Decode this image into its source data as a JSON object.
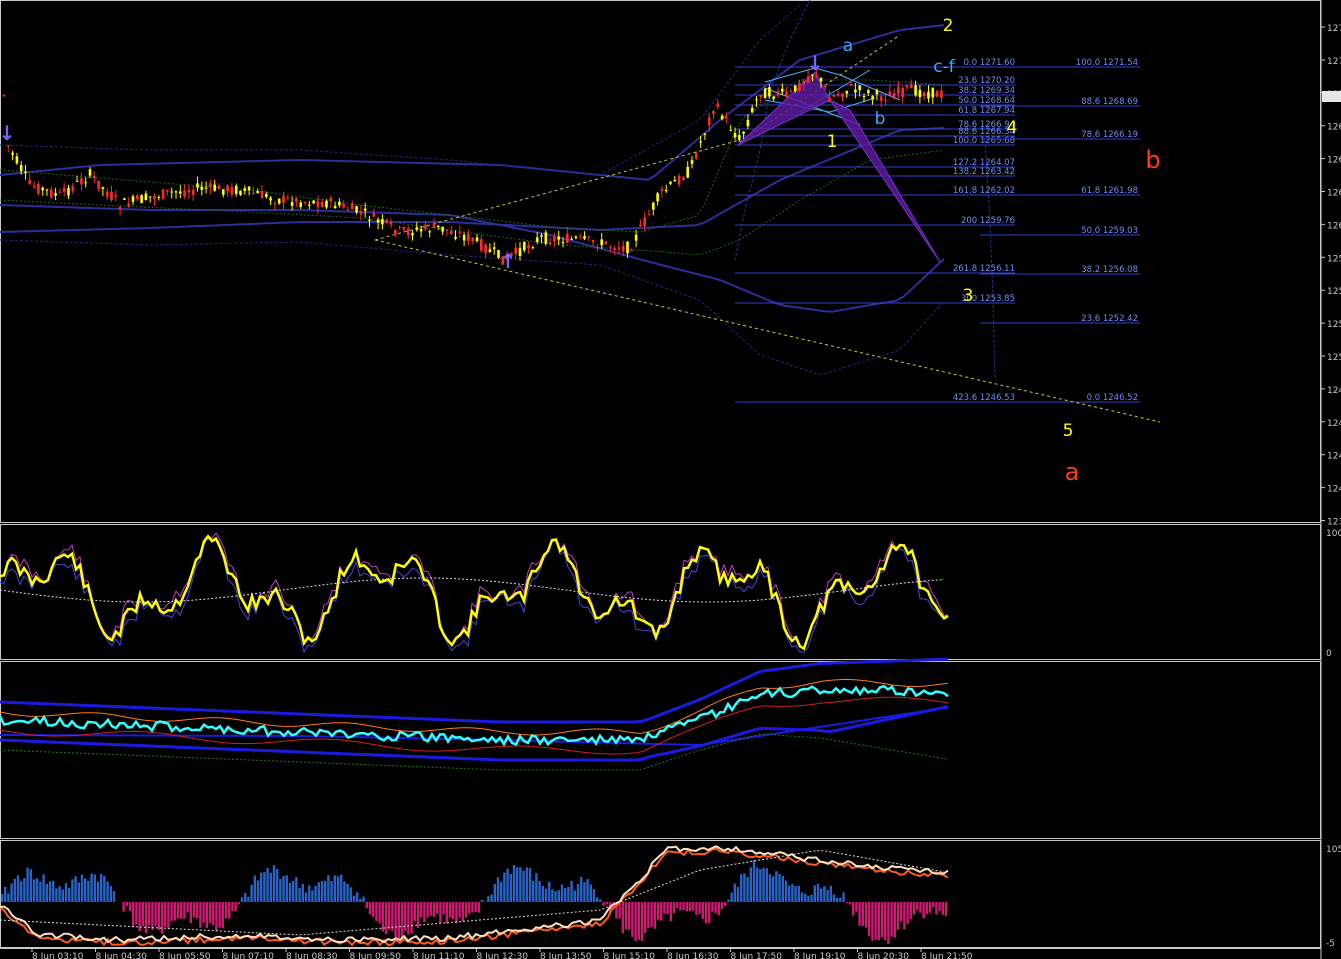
{
  "colors": {
    "background": "#000000",
    "frame": "#c8c8c8",
    "candle_up": "#ffff00",
    "candle_down": "#ff2a2a",
    "fib_line": "#3340d0",
    "fib_text": "#6f8cf0",
    "wave_yellow": "#ffff00",
    "wave_red": "#ff3d14",
    "wave_cyan": "#3fa9ff",
    "harmonic_fill": "#5a1a9a",
    "stoch_main": "#ffff00",
    "bb_cyan": "#33ffff",
    "hist_blue": "#2a63c8",
    "hist_pink": "#cc1a70",
    "osc_line": "#ffe0c0"
  },
  "markers": {
    "arrow_down": "↓",
    "arrow_up": "↑"
  },
  "price_axis": {
    "labels": [
      "127",
      "127",
      "127",
      "126",
      "126",
      "126",
      "126",
      "125",
      "125",
      "125",
      "125",
      "124",
      "124",
      "124",
      "124",
      "123"
    ]
  },
  "fib_left": [
    {
      "label": "0.0 1271.60"
    },
    {
      "label": "23.6 1270.20"
    },
    {
      "label": "38.2 1269.34"
    },
    {
      "label": "50.0 1268.64"
    },
    {
      "label": "61.8 1267.94"
    },
    {
      "label": "78.6 1266.94"
    },
    {
      "label": "88.6 1266.34"
    },
    {
      "label": "100.0 1265.68"
    },
    {
      "label": "127.2 1264.07"
    },
    {
      "label": "138.2 1263.42"
    },
    {
      "label": "161.8 1262.02"
    },
    {
      "label": "200 1259.76"
    },
    {
      "label": "261.8 1256.11"
    },
    {
      "label": "300 1253.85"
    },
    {
      "label": "423.6 1246.53"
    }
  ],
  "fib_right": [
    {
      "label": "100.0 1271.54"
    },
    {
      "label": "88.6 1268.69"
    },
    {
      "label": "78.6 1266.19"
    },
    {
      "label": "61.8 1261.98"
    },
    {
      "label": "50.0 1259.03"
    },
    {
      "label": "38.2 1256.08"
    },
    {
      "label": "23.6 1252.42"
    },
    {
      "label": "0.0 1246.52"
    }
  ],
  "waves": {
    "w1": "1",
    "w2": "2",
    "w3": "3",
    "w4": "4",
    "w5": "5",
    "wa": "a",
    "wb": "b",
    "wcf": "c-f",
    "big_a": "a",
    "big_b": "b"
  },
  "panels": {
    "stoch_top": "100",
    "stoch_bottom": "0",
    "osc_top": "105",
    "osc_bottom": "-5"
  },
  "time_axis": {
    "labels": [
      "8 Jun 03:10",
      "8 Jun 04:30",
      "8 Jun 05:50",
      "8 Jun 07:10",
      "8 Jun 08:30",
      "8 Jun 09:50",
      "8 Jun 11:10",
      "8 Jun 12:30",
      "8 Jun 13:50",
      "8 Jun 15:10",
      "8 Jun 16:30",
      "8 Jun 17:50",
      "8 Jun 19:10",
      "8 Jun 20:30",
      "8 Jun 21:50"
    ]
  }
}
